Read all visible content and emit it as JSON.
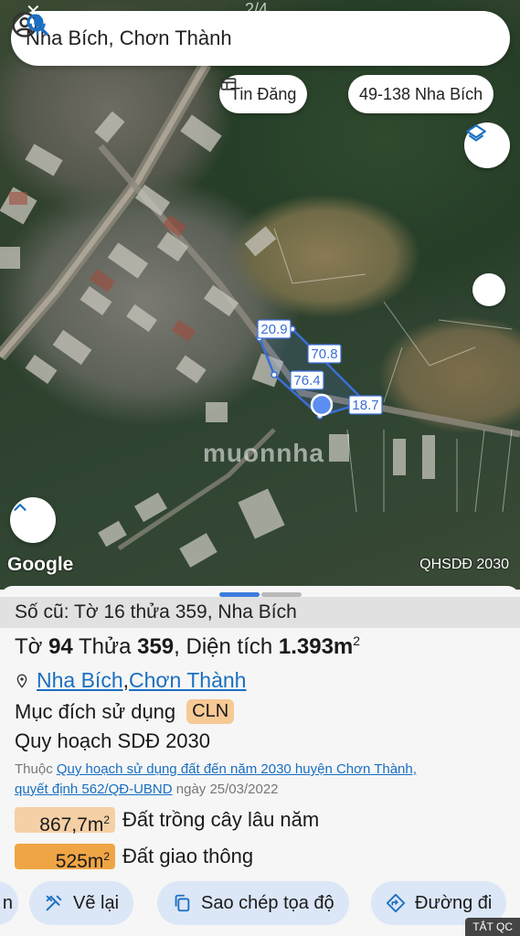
{
  "status_bar": {
    "back_glyph": "✕",
    "counter": "2/4"
  },
  "search": {
    "query": "Nha Bích, Chơn Thành",
    "left_icon": "account-circle-icon",
    "icons": [
      "search-icon",
      "mic-icon"
    ]
  },
  "chips": {
    "listings_label": "Tin Đăng",
    "parcel_label": "49-138 Nha Bích"
  },
  "map": {
    "watermark": "muonnha",
    "provider": "Google",
    "layer_label": "QHSDĐ 2030",
    "parcel_edges": [
      "20.9",
      "70.8",
      "76.4",
      "18.7"
    ],
    "colors": {
      "parcel_outline": "#3a6fd6",
      "edge_label_bg": "#ffffff",
      "location_dot": "#5b8ef0"
    }
  },
  "sheet": {
    "old_info": "Số cũ: Tờ 16 thửa 359, Nha Bích",
    "sheet_prefix": "Tờ ",
    "sheet_no": "94",
    "lot_prefix": " Thửa ",
    "lot_no": "359",
    "area_prefix": ", Diện tích ",
    "area_value": "1.393m",
    "area_sup": "2",
    "commune": "Nha Bích",
    "separator": ", ",
    "district": "Chơn Thành",
    "purpose_label": "Mục đích sử dụng",
    "purpose_code": "CLN",
    "plan_title": "Quy hoạch SDĐ 2030",
    "plan_prefix": "Thuộc ",
    "plan_link": "Quy hoạch sử dụng đất đến năm 2030 huyện Chơn Thành,",
    "decision_link": "quyết định 562/QĐ-UBND",
    "decision_date": " ngày 25/03/2022",
    "legend": [
      {
        "value": "867,7m",
        "sup": "2",
        "label": "Đất trồng cây lâu năm",
        "color": "#f5d0a6"
      },
      {
        "value": "525m",
        "sup": "2",
        "label": "Đất giao thông",
        "color": "#f0a545"
      }
    ]
  },
  "buttons": {
    "partial": "n",
    "redraw": "Vẽ lại",
    "copy_coords": "Sao chép tọa độ",
    "directions": "Đường đi"
  },
  "ad_badge": "TẮT QC",
  "colors": {
    "accent": "#1a6fc2",
    "button_bg": "#dbe6f6",
    "handle_active": "#3b7ddd",
    "handle_inactive": "#b9b9b9"
  }
}
